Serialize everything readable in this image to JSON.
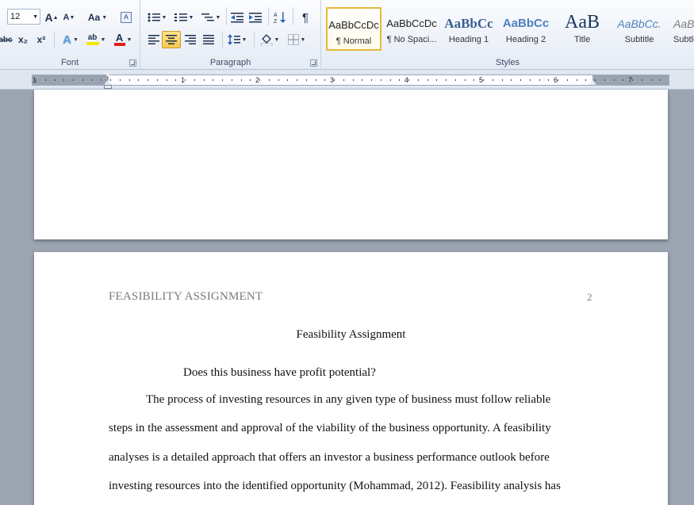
{
  "ribbon": {
    "font_group": {
      "label": "Font",
      "font_size": "12",
      "grow_label": "A",
      "shrink_label": "A",
      "change_case_label": "Aa",
      "strikethrough_label": "abc",
      "subscript_label": "x₂",
      "superscript_label": "x²",
      "text_effects_label": "A",
      "highlight_label": "ab",
      "font_color_label": "A",
      "font_color": "#e0201b",
      "highlight_color": "#f5e400"
    },
    "paragraph_group": {
      "label": "Paragraph",
      "pilcrow": "¶"
    },
    "styles_group": {
      "label": "Styles",
      "items": [
        {
          "preview": "AaBbCcDc",
          "name": "¶ Normal"
        },
        {
          "preview": "AaBbCcDc",
          "name": "¶ No Spaci..."
        },
        {
          "preview": "AaBbCc",
          "name": "Heading 1"
        },
        {
          "preview": "AaBbCc",
          "name": "Heading 2"
        },
        {
          "preview": "AaB",
          "name": "Title"
        },
        {
          "preview": "AaBbCc.",
          "name": "Subtitle"
        },
        {
          "preview": "AaBbC",
          "name": "Subtle"
        }
      ]
    }
  },
  "ruler": {
    "numbers": [
      "1",
      "1",
      "2",
      "3",
      "4",
      "5",
      "6",
      "7"
    ]
  },
  "document": {
    "header_title": "FEASIBILITY ASSIGNMENT",
    "page_number": "2",
    "title": "Feasibility Assignment",
    "question": "Does this business have profit potential?",
    "lines": [
      "The process of investing resources in  any given type of business must follow reliable",
      "steps in the assessment and approval of the viability of the business opportunity. A feasibility",
      "analyses is a detailed approach that offers an investor a business performance outlook before",
      "investing resources into the identified opportunity (Mohammad, 2012). Feasibility analysis has"
    ]
  }
}
